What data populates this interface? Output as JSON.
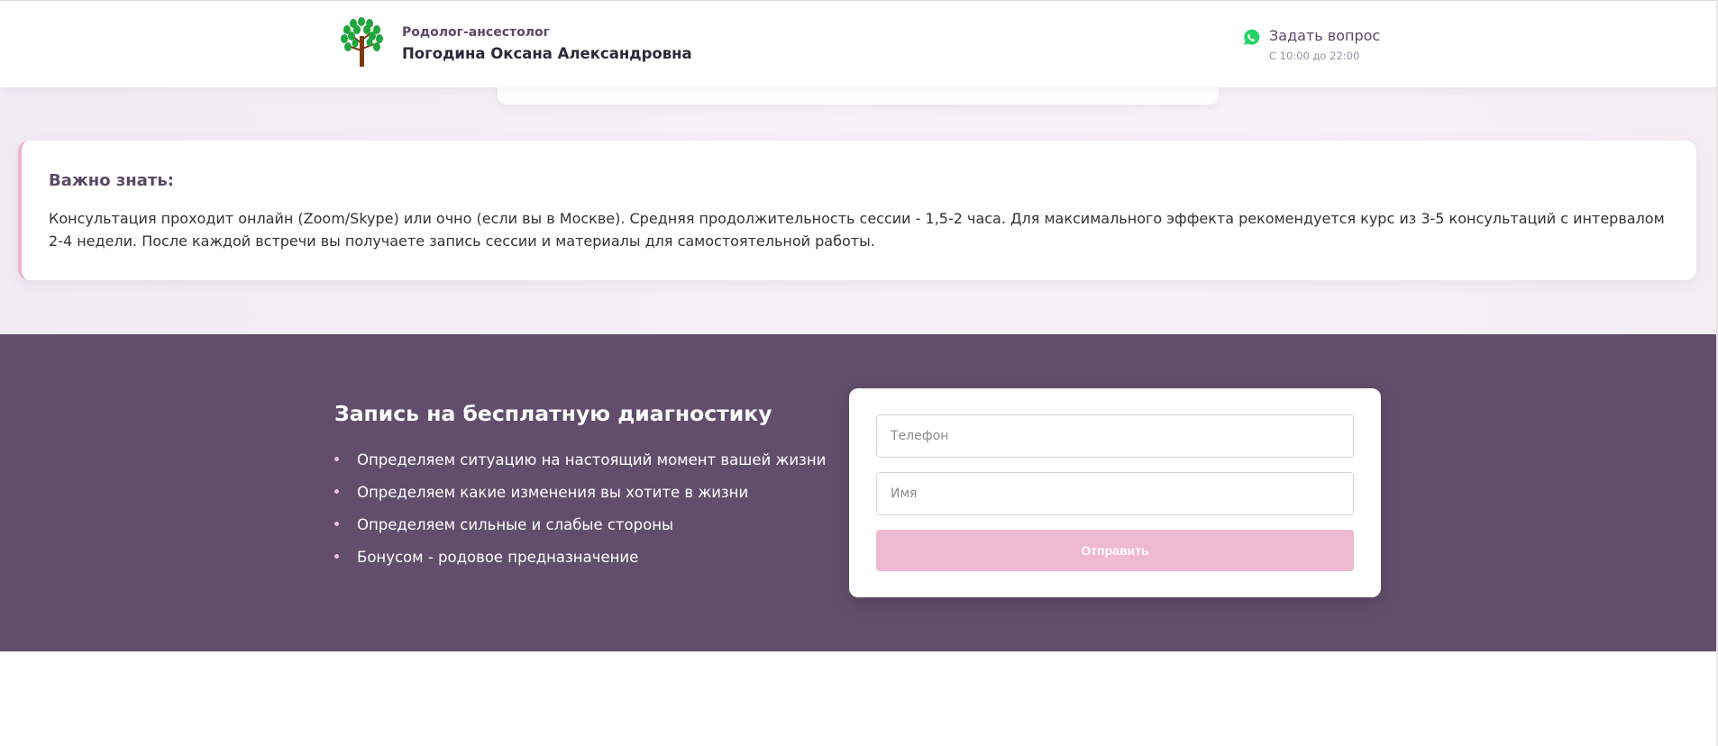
{
  "header": {
    "subtitle": "Родолог-ансестолог",
    "name": "Погодина Оксана Александровна",
    "ask_label": "Задать вопрос",
    "hours": "С 10:00 до 22:00",
    "logo_icon": "tree-icon",
    "contact_icon": "whatsapp-icon"
  },
  "info": {
    "title": "Важно знать:",
    "text": "Консультация проходит онлайн (Zoom/Skype) или очно (если вы в Москве). Средняя продолжительность сессии - 1,5-2 часа. Для максимального эффекта рекомендуется курс из 3-5 консультаций с интервалом 2-4 недели. После каждой встречи вы получаете запись сессии и материалы для самостоятельной работы."
  },
  "signup": {
    "title": "Запись на бесплатную диагностику",
    "items": [
      "Определяем ситуацию на настоящий момент вашей жизни",
      "Определяем какие изменения вы хотите в жизни",
      "Определяем сильные и слабые стороны",
      "Бонусом - родовое предназначение"
    ],
    "form": {
      "phone_placeholder": "Телефон",
      "name_placeholder": "Имя",
      "submit_label": "Отправить"
    }
  },
  "colors": {
    "accent_purple": "#624e6c",
    "accent_pink": "#f0b9d2",
    "whatsapp_green": "#25d366",
    "tree_green": "#1fa53c",
    "tree_trunk": "#7a3b12"
  }
}
